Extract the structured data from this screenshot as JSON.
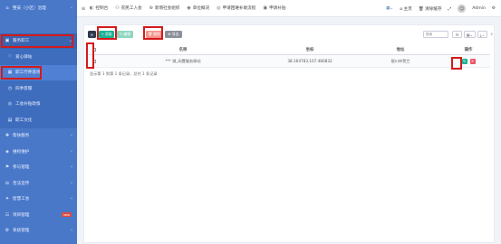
{
  "sidebar": {
    "items": [
      {
        "label": "整安（小区）治理",
        "icon": "home-icon",
        "chevron": true
      },
      {
        "label": "服务职工",
        "icon": "users-icon",
        "chevron": true
      },
      {
        "label": "爱心驿站",
        "icon": "heart-icon"
      },
      {
        "label": "职工疗养基地",
        "icon": "building-icon"
      },
      {
        "label": "四季客服",
        "icon": "service-icon"
      },
      {
        "label": "工会补贴政策",
        "icon": "gift-icon"
      },
      {
        "label": "职工文化",
        "icon": "book-icon"
      },
      {
        "label": "帮扶服务",
        "icon": "help-icon",
        "chevron": true
      },
      {
        "label": "维权维护",
        "icon": "shield-icon",
        "chevron": true
      },
      {
        "label": "参与管理",
        "icon": "flag-icon",
        "chevron": true
      },
      {
        "label": "普法宣传",
        "icon": "gavel-icon",
        "chevron": true
      },
      {
        "label": "智慧工会",
        "icon": "bulb-icon",
        "chevron": true
      },
      {
        "label": "项目管理",
        "icon": "project-icon",
        "badge": "new"
      },
      {
        "label": "系统管理",
        "icon": "gear-icon",
        "chevron": true
      }
    ]
  },
  "topbar": {
    "nav": [
      {
        "label": "控制台",
        "icon": "dashboard-icon"
      },
      {
        "label": "农民工入会",
        "icon": "user-add-icon"
      },
      {
        "label": "新增社会组织",
        "icon": "plus-circle-icon"
      },
      {
        "label": "单位概况",
        "icon": "info-icon"
      },
      {
        "label": "申请困难补助流程",
        "icon": "flow-icon"
      },
      {
        "label": "申请补贴",
        "icon": "money-icon"
      }
    ],
    "right": {
      "grid_icon": "grid-icon",
      "home_label": "主页",
      "clear_label": "清除缓存",
      "user_name": "Admin"
    }
  },
  "toolbar": {
    "add_label": "+ 添加",
    "edit_label": "✎ 编辑",
    "delete_label": "🗑 删除",
    "export_label": "⊕ 导出",
    "search_placeholder": "搜索"
  },
  "table": {
    "columns": [
      "名称",
      "坐标",
      "地址",
      "操作"
    ],
    "rows": [
      {
        "name": "*** 湖_闲置服务驿站",
        "coords": "38.164783,107.480832",
        "address": "银川市贺兰"
      }
    ],
    "pager": "显示第 1 到第 1 条记录，总共 1 条记录"
  }
}
